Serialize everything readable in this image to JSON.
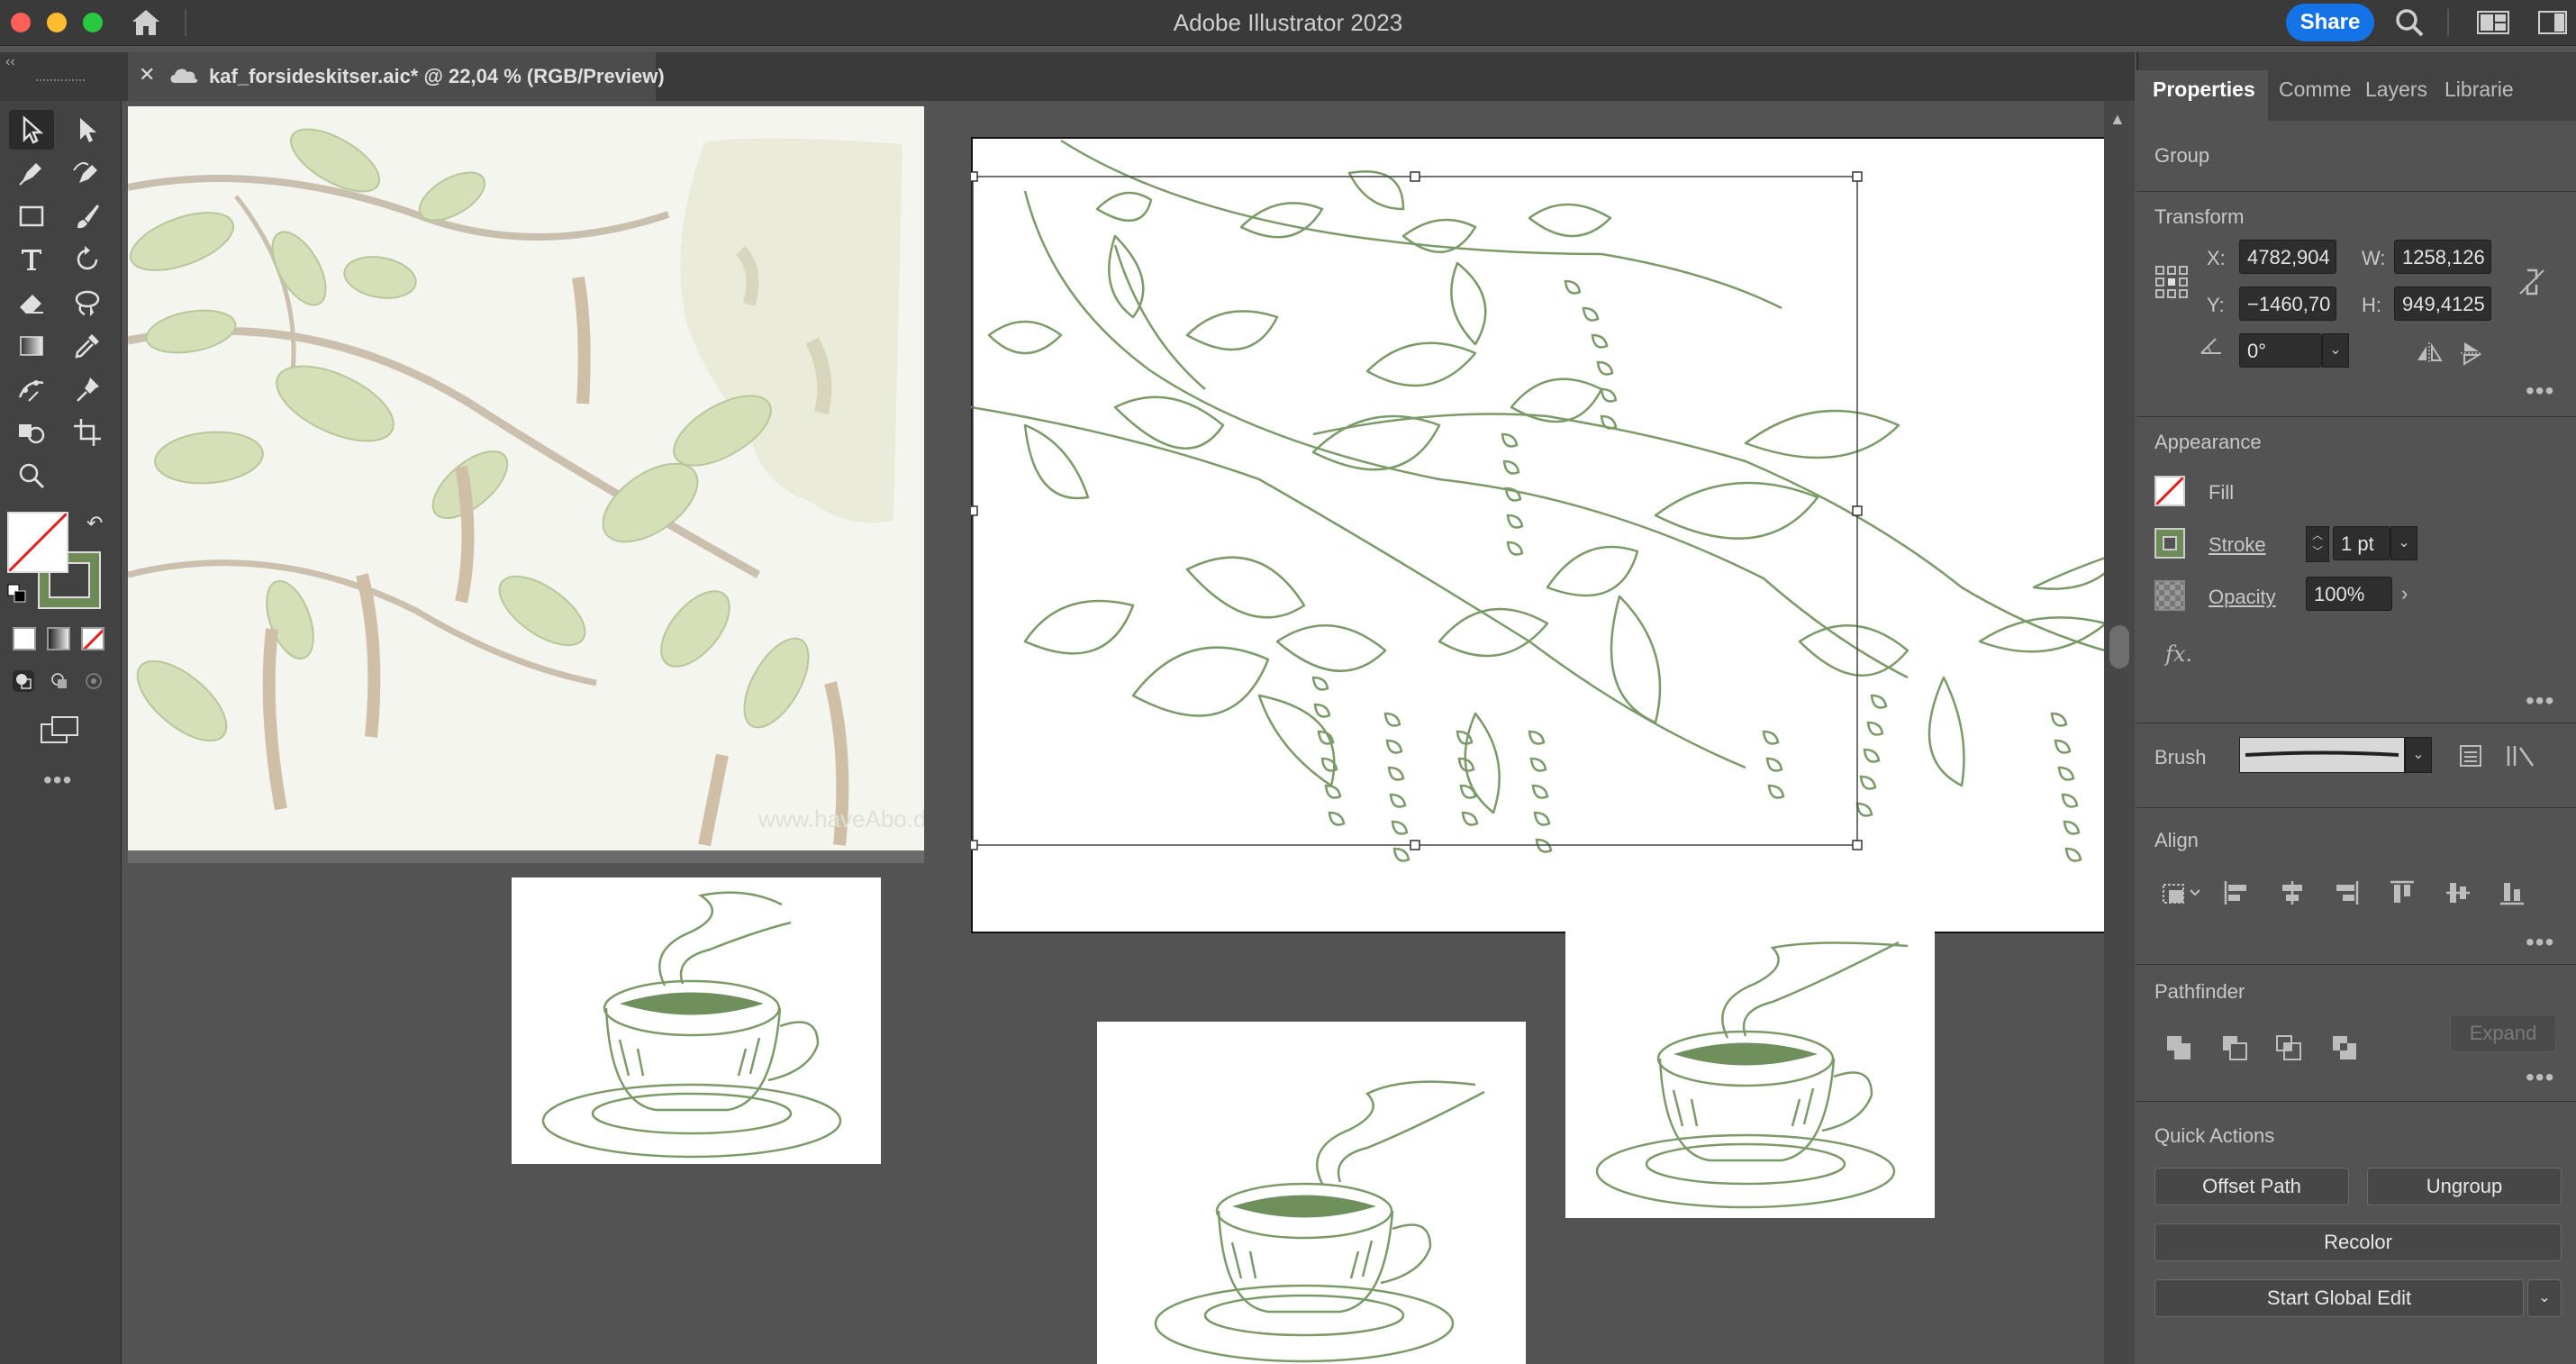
{
  "window": {
    "title": "Adobe Illustrator 2023",
    "share_label": "Share"
  },
  "document_tab": {
    "title": "kaf_forsideskitser.aic* @ 22,04 % (RGB/Preview)"
  },
  "colors": {
    "accent": "#1473e6",
    "sketch_green": "#7a9a68",
    "panel_bg": "#424242",
    "canvas_bg": "#535353"
  },
  "canvas": {
    "watermark_text": "www.haveAbo.dk"
  },
  "panel": {
    "tabs": [
      "Properties",
      "Comme",
      "Layers",
      "Librarie"
    ],
    "selection_type": "Group",
    "transform": {
      "title": "Transform",
      "x_label": "X:",
      "x_value": "4782,904",
      "y_label": "Y:",
      "y_value": "−1460,70",
      "w_label": "W:",
      "w_value": "1258,126",
      "h_label": "H:",
      "h_value": "949,4125",
      "angle_value": "0°"
    },
    "appearance": {
      "title": "Appearance",
      "fill_label": "Fill",
      "stroke_label": "Stroke",
      "stroke_value": "1 pt",
      "opacity_label": "Opacity",
      "opacity_value": "100%",
      "fx_label": "fx."
    },
    "brush": {
      "label": "Brush"
    },
    "align": {
      "title": "Align"
    },
    "pathfinder": {
      "title": "Pathfinder",
      "expand_label": "Expand"
    },
    "quick_actions": {
      "title": "Quick Actions",
      "offset_path": "Offset Path",
      "ungroup": "Ungroup",
      "recolor": "Recolor",
      "start_global_edit": "Start Global Edit"
    }
  }
}
